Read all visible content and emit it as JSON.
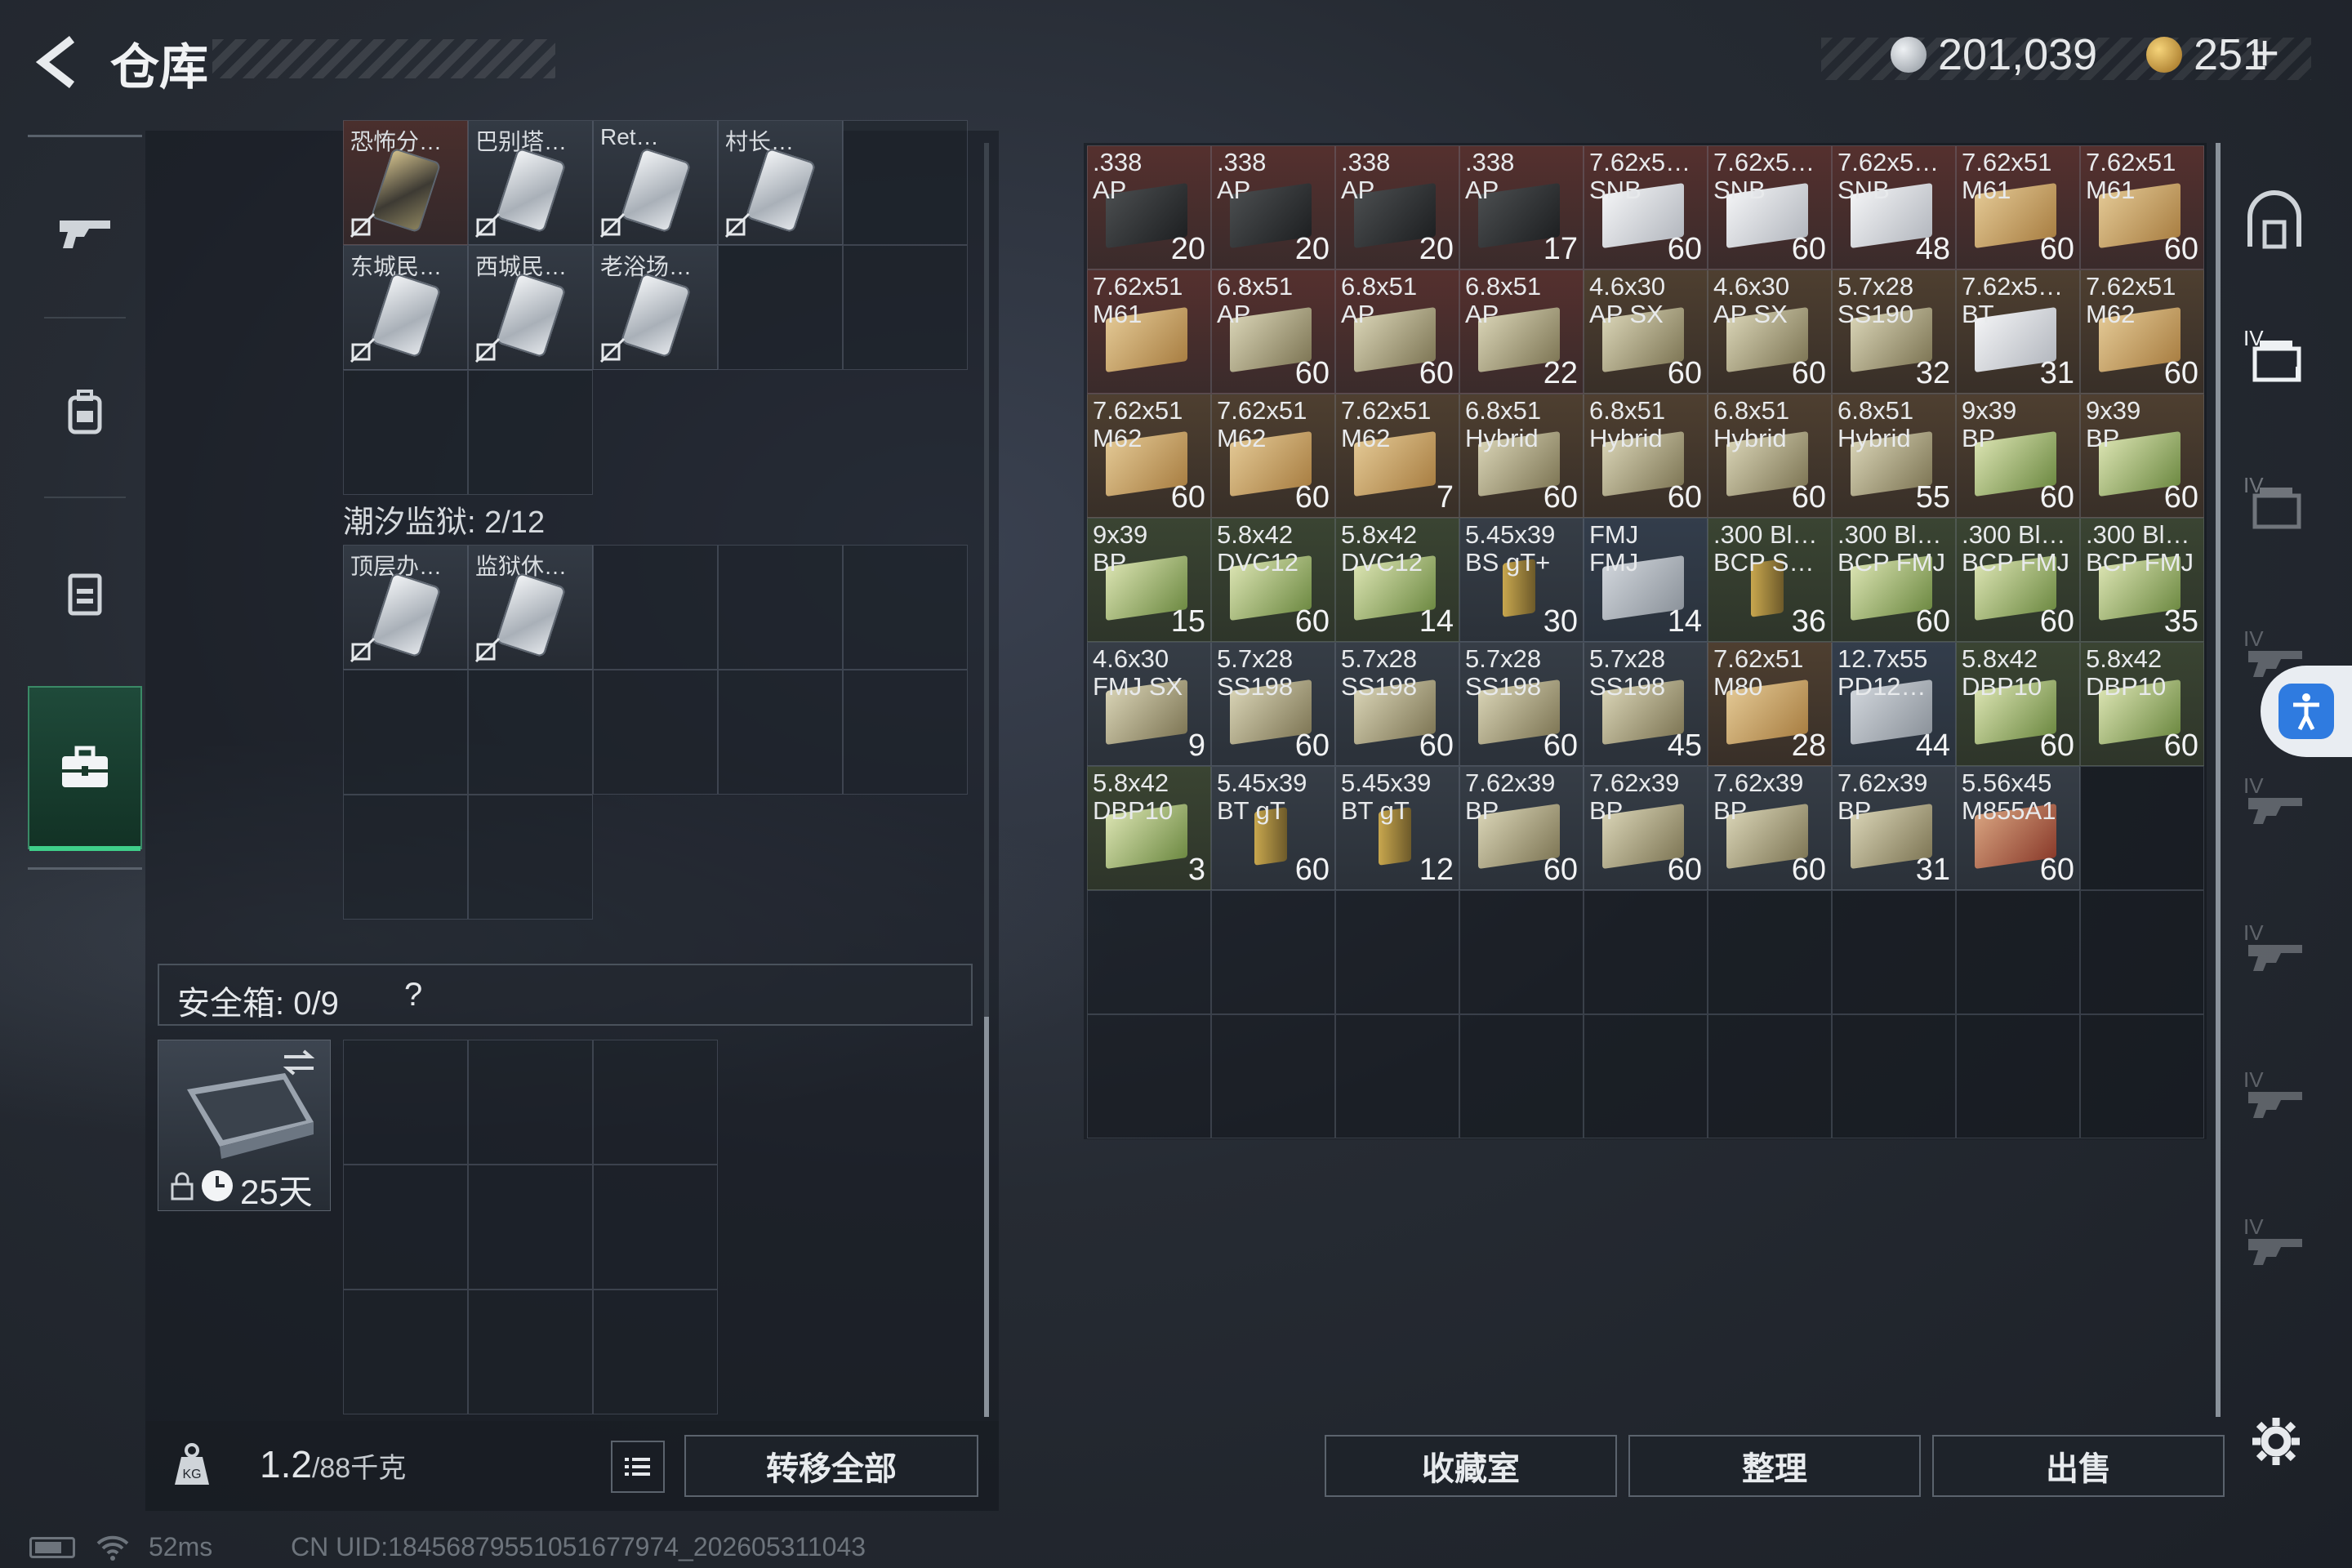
{
  "header": {
    "title": "仓库",
    "currency1": "201,039",
    "currency2": "251",
    "add": "+"
  },
  "left_nav": [
    "gun-icon",
    "backpack-icon",
    "vest-icon",
    "briefcase-icon"
  ],
  "stash_cards_top": [
    {
      "name": "恐怖分…",
      "red": true
    },
    {
      "name": "巴别塔…",
      "red": false
    },
    {
      "name": "Ret…",
      "red": false
    },
    {
      "name": "村长…",
      "red": false
    },
    {
      "name": "东城民…",
      "red": false
    },
    {
      "name": "西城民…",
      "red": false
    },
    {
      "name": "老浴场…",
      "red": false
    }
  ],
  "section_prison": {
    "label": "潮汐监狱: 2/12",
    "cards": [
      {
        "name": "顶层办…"
      },
      {
        "name": "监狱休…"
      }
    ]
  },
  "safe_box": {
    "label": "安全箱: 0/9",
    "help": "?",
    "days": "25天"
  },
  "bottom_left": {
    "weight": "1.2",
    "capacity": "/88千克",
    "transfer_all": "转移全部"
  },
  "ammo": [
    {
      "l1": ".338",
      "l2": "AP",
      "q": "20",
      "c": "r",
      "bx": "dark"
    },
    {
      "l1": ".338",
      "l2": "AP",
      "q": "20",
      "c": "r",
      "bx": "dark"
    },
    {
      "l1": ".338",
      "l2": "AP",
      "q": "20",
      "c": "r",
      "bx": "dark"
    },
    {
      "l1": ".338",
      "l2": "AP",
      "q": "17",
      "c": "r",
      "bx": "dark"
    },
    {
      "l1": "7.62x5…",
      "l2": "SNB",
      "q": "60",
      "c": "r",
      "bx": "white"
    },
    {
      "l1": "7.62x5…",
      "l2": "SNB",
      "q": "60",
      "c": "r",
      "bx": "white"
    },
    {
      "l1": "7.62x5…",
      "l2": "SNB",
      "q": "48",
      "c": "r",
      "bx": "white"
    },
    {
      "l1": "7.62x51",
      "l2": "M61",
      "q": "60",
      "c": "r",
      "bx": "tan"
    },
    {
      "l1": "7.62x51",
      "l2": "M61",
      "q": "60",
      "c": "r",
      "bx": "tan"
    },
    {
      "l1": "7.62x51",
      "l2": "M61",
      "q": "",
      "c": "r",
      "bx": "tan"
    },
    {
      "l1": "6.8x51",
      "l2": "AP",
      "q": "60",
      "c": "r",
      "bx": "olive"
    },
    {
      "l1": "6.8x51",
      "l2": "AP",
      "q": "60",
      "c": "r",
      "bx": "olive"
    },
    {
      "l1": "6.8x51",
      "l2": "AP",
      "q": "22",
      "c": "r",
      "bx": "olive"
    },
    {
      "l1": "4.6x30",
      "l2": "AP SX",
      "q": "60",
      "c": "o",
      "bx": "olive"
    },
    {
      "l1": "4.6x30",
      "l2": "AP SX",
      "q": "60",
      "c": "o",
      "bx": "olive"
    },
    {
      "l1": "5.7x28",
      "l2": "SS190",
      "q": "32",
      "c": "o",
      "bx": "olive"
    },
    {
      "l1": "7.62x5…",
      "l2": "BT",
      "q": "31",
      "c": "o",
      "bx": "white"
    },
    {
      "l1": "7.62x51",
      "l2": "M62",
      "q": "60",
      "c": "o",
      "bx": "tan"
    },
    {
      "l1": "7.62x51",
      "l2": "M62",
      "q": "60",
      "c": "o",
      "bx": "tan"
    },
    {
      "l1": "7.62x51",
      "l2": "M62",
      "q": "60",
      "c": "o",
      "bx": "tan"
    },
    {
      "l1": "7.62x51",
      "l2": "M62",
      "q": "7",
      "c": "o",
      "bx": "tan"
    },
    {
      "l1": "6.8x51",
      "l2": "Hybrid",
      "q": "60",
      "c": "o",
      "bx": "olive"
    },
    {
      "l1": "6.8x51",
      "l2": "Hybrid",
      "q": "60",
      "c": "o",
      "bx": "olive"
    },
    {
      "l1": "6.8x51",
      "l2": "Hybrid",
      "q": "60",
      "c": "o",
      "bx": "olive"
    },
    {
      "l1": "6.8x51",
      "l2": "Hybrid",
      "q": "55",
      "c": "o",
      "bx": "olive"
    },
    {
      "l1": "9x39",
      "l2": "BP",
      "q": "60",
      "c": "o",
      "bx": "green"
    },
    {
      "l1": "9x39",
      "l2": "BP",
      "q": "60",
      "c": "o",
      "bx": "green"
    },
    {
      "l1": "9x39",
      "l2": "BP",
      "q": "15",
      "c": "g",
      "bx": "green"
    },
    {
      "l1": "5.8x42",
      "l2": "DVC12",
      "q": "60",
      "c": "g",
      "bx": "green"
    },
    {
      "l1": "5.8x42",
      "l2": "DVC12",
      "q": "14",
      "c": "g",
      "bx": "green"
    },
    {
      "l1": "5.45x39",
      "l2": "BS gT+",
      "q": "30",
      "c": "filled",
      "bx": "bullet"
    },
    {
      "l1": "FMJ",
      "l2": "FMJ",
      "q": "14",
      "c": "b",
      "bx": "gray"
    },
    {
      "l1": ".300 Bl…",
      "l2": "BCP S…",
      "q": "36",
      "c": "g",
      "bx": "bullet"
    },
    {
      "l1": ".300 Bl…",
      "l2": "BCP FMJ",
      "q": "60",
      "c": "g",
      "bx": "green"
    },
    {
      "l1": ".300 Bl…",
      "l2": "BCP FMJ",
      "q": "60",
      "c": "g",
      "bx": "green"
    },
    {
      "l1": ".300 Bl…",
      "l2": "BCP FMJ",
      "q": "35",
      "c": "g",
      "bx": "green"
    },
    {
      "l1": "4.6x30",
      "l2": "FMJ SX",
      "q": "9",
      "c": "filled",
      "bx": "olive"
    },
    {
      "l1": "5.7x28",
      "l2": "SS198",
      "q": "60",
      "c": "filled",
      "bx": "olive"
    },
    {
      "l1": "5.7x28",
      "l2": "SS198",
      "q": "60",
      "c": "filled",
      "bx": "olive"
    },
    {
      "l1": "5.7x28",
      "l2": "SS198",
      "q": "60",
      "c": "filled",
      "bx": "olive"
    },
    {
      "l1": "5.7x28",
      "l2": "SS198",
      "q": "45",
      "c": "filled",
      "bx": "olive"
    },
    {
      "l1": "7.62x51",
      "l2": "M80",
      "q": "28",
      "c": "o",
      "bx": "tan"
    },
    {
      "l1": "12.7x55",
      "l2": "PD12…",
      "q": "44",
      "c": "b",
      "bx": "gray"
    },
    {
      "l1": "5.8x42",
      "l2": "DBP10",
      "q": "60",
      "c": "g",
      "bx": "green"
    },
    {
      "l1": "5.8x42",
      "l2": "DBP10",
      "q": "60",
      "c": "g",
      "bx": "green"
    },
    {
      "l1": "5.8x42",
      "l2": "DBP10",
      "q": "3",
      "c": "g",
      "bx": "green"
    },
    {
      "l1": "5.45x39",
      "l2": "BT gT",
      "q": "60",
      "c": "filled",
      "bx": "bullet"
    },
    {
      "l1": "5.45x39",
      "l2": "BT gT",
      "q": "12",
      "c": "filled",
      "bx": "bullet"
    },
    {
      "l1": "7.62x39",
      "l2": "BP",
      "q": "60",
      "c": "filled",
      "bx": "olive"
    },
    {
      "l1": "7.62x39",
      "l2": "BP",
      "q": "60",
      "c": "filled",
      "bx": "olive"
    },
    {
      "l1": "7.62x39",
      "l2": "BP",
      "q": "60",
      "c": "filled",
      "bx": "olive"
    },
    {
      "l1": "7.62x39",
      "l2": "BP",
      "q": "31",
      "c": "filled",
      "bx": "olive"
    },
    {
      "l1": "5.56x45",
      "l2": "M855A1",
      "q": "60",
      "c": "filled",
      "bx": "red"
    }
  ],
  "bottom_right": {
    "collection": "收藏室",
    "sort": "整理",
    "sell": "出售"
  },
  "status": {
    "ping": "52ms",
    "uid": "CN UID:18456879551051677974_202605311043"
  },
  "colors": {
    "accent_green": "#3fcf8a",
    "coin_silver": "#b9c0c8",
    "coin_gold": "#d9a33c",
    "access_blue": "#2f7be0"
  }
}
